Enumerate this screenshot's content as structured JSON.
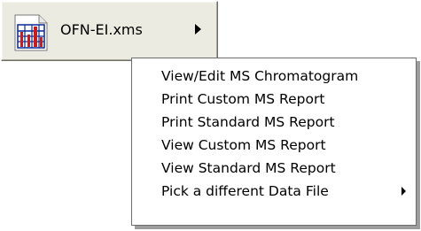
{
  "file_button": {
    "label": "OFN-EI.xms",
    "icon": "chromatogram-document-icon",
    "arrow_icon": "triangle-right-icon"
  },
  "menu": {
    "items": [
      {
        "label": "View/Edit MS Chromatogram"
      },
      {
        "label": "Print Custom MS Report"
      },
      {
        "label": "Print Standard MS Report"
      },
      {
        "label": "View Custom MS Report"
      },
      {
        "label": "View Standard MS Report"
      },
      {
        "label": "Pick a different Data File",
        "icon": "submenu-arrow-icon"
      }
    ]
  },
  "colors": {
    "button_face": "#ecebe1",
    "menu_background": "#ffffff",
    "menu_border": "#6d6d6d",
    "icon_accent": "#c41e1e",
    "icon_frame": "#0a2a9a"
  }
}
